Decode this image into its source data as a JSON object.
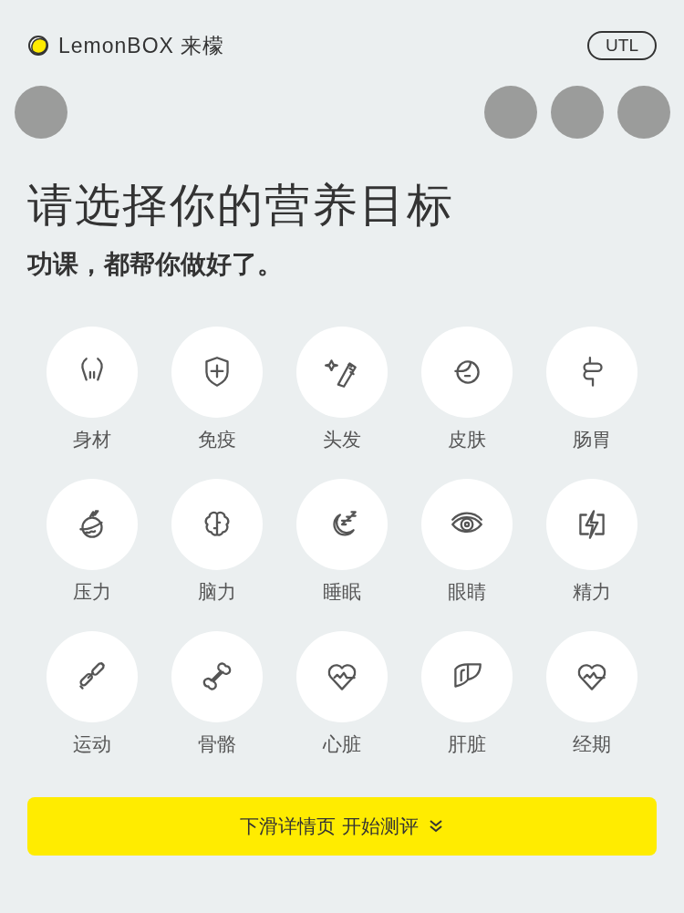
{
  "header": {
    "brand": "LemonBOX 来檬",
    "badge": "UTL"
  },
  "title": "请选择你的营养目标",
  "subtitle": "功课，都帮你做好了。",
  "goals": [
    {
      "label": "身材"
    },
    {
      "label": "免疫"
    },
    {
      "label": "头发"
    },
    {
      "label": "皮肤"
    },
    {
      "label": "肠胃"
    },
    {
      "label": "压力"
    },
    {
      "label": "脑力"
    },
    {
      "label": "睡眠"
    },
    {
      "label": "眼睛"
    },
    {
      "label": "精力"
    },
    {
      "label": "运动"
    },
    {
      "label": "骨骼"
    },
    {
      "label": "心脏"
    },
    {
      "label": "肝脏"
    },
    {
      "label": "经期"
    }
  ],
  "cta": {
    "label": "下滑详情页 开始测评"
  }
}
